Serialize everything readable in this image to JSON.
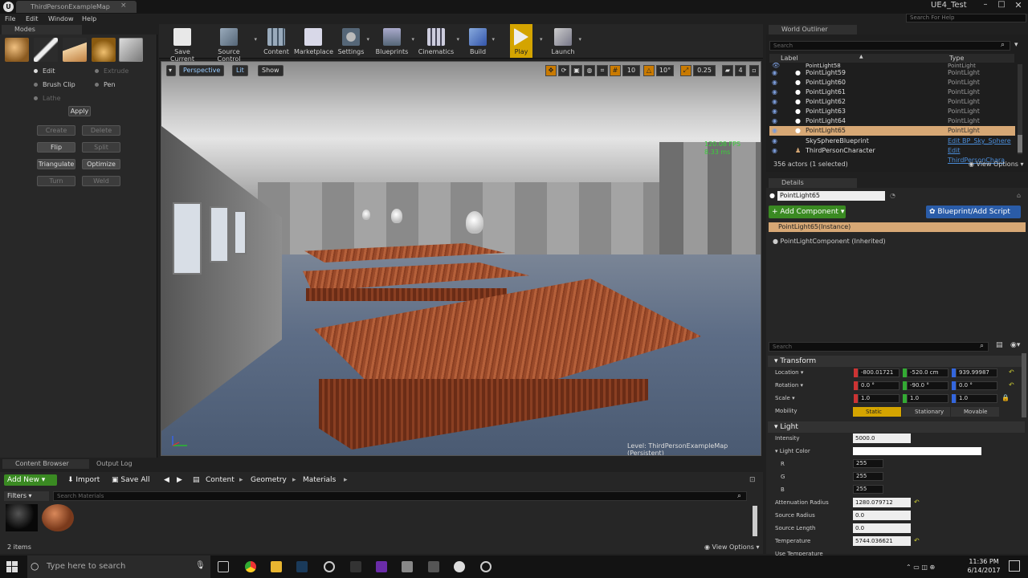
{
  "window": {
    "doc_tab": "ThirdPersonExampleMap",
    "project_name": "UE4_Test",
    "help_search_placeholder": "Search For Help"
  },
  "menu": [
    "File",
    "Edit",
    "Window",
    "Help"
  ],
  "modes": {
    "tab": "Modes",
    "radios": {
      "edit": "Edit",
      "extrude": "Extrude",
      "brush_clip": "Brush Clip",
      "pen": "Pen",
      "lathe": "Lathe"
    },
    "apply": "Apply",
    "buttons": {
      "create": "Create",
      "delete": "Delete",
      "flip": "Flip",
      "split": "Split",
      "triangulate": "Triangulate",
      "optimize": "Optimize",
      "turn": "Turn",
      "weld": "Weld"
    }
  },
  "toolbar": {
    "save_current": "Save Current",
    "source_control": "Source Control",
    "content": "Content",
    "marketplace": "Marketplace",
    "settings": "Settings",
    "blueprints": "Blueprints",
    "cinematics": "Cinematics",
    "build": "Build",
    "play": "Play",
    "launch": "Launch"
  },
  "viewport": {
    "perspective": "Perspective",
    "lit": "Lit",
    "show": "Show",
    "grid_snap": "10",
    "rot_snap": "10°",
    "scale_snap": "0.25",
    "cam_speed": "4",
    "fps": "120.08 FPS",
    "ms": "8.33 ms",
    "level": "Level:  ThirdPersonExampleMap (Persistent)"
  },
  "outliner": {
    "tab": "World Outliner",
    "search_placeholder": "Search",
    "col_label": "Label",
    "col_type": "Type",
    "rows": [
      {
        "label": "PointLight58",
        "type": "PointLight"
      },
      {
        "label": "PointLight59",
        "type": "PointLight"
      },
      {
        "label": "PointLight60",
        "type": "PointLight"
      },
      {
        "label": "PointLight61",
        "type": "PointLight"
      },
      {
        "label": "PointLight62",
        "type": "PointLight"
      },
      {
        "label": "PointLight63",
        "type": "PointLight"
      },
      {
        "label": "PointLight64",
        "type": "PointLight"
      },
      {
        "label": "PointLight65",
        "type": "PointLight"
      },
      {
        "label": "SkySphereBlueprint",
        "type": "Edit BP_Sky_Sphere"
      },
      {
        "label": "ThirdPersonCharacter",
        "type": "Edit ThirdPersonChara"
      }
    ],
    "count": "356 actors (1 selected)",
    "view_options": "View Options"
  },
  "details": {
    "tab": "Details",
    "actor_name": "PointLight65",
    "add_component": "+ Add Component",
    "blueprint_script": "Blueprint/Add Script",
    "instance": "PointLight65(Instance)",
    "component": "PointLightComponent (Inherited)",
    "search_placeholder": "Search",
    "transform": {
      "header": "Transform",
      "location_label": "Location",
      "location": [
        "-800.01721",
        "-520.0 cm",
        "939.99987"
      ],
      "rotation_label": "Rotation",
      "rotation": [
        "0.0 °",
        "-90.0 °",
        "0.0 °"
      ],
      "scale_label": "Scale",
      "scale": [
        "1.0",
        "1.0",
        "1.0"
      ],
      "mobility_label": "Mobility",
      "mobility": [
        "Static",
        "Stationary",
        "Movable"
      ]
    },
    "light": {
      "header": "Light",
      "intensity_label": "Intensity",
      "intensity": "5000.0",
      "light_color_label": "Light Color",
      "r_label": "R",
      "r": "255",
      "g_label": "G",
      "g": "255",
      "b_label": "B",
      "b": "255",
      "attenuation_label": "Attenuation Radius",
      "attenuation": "1280.079712",
      "source_radius_label": "Source Radius",
      "source_radius": "0.0",
      "source_length_label": "Source Length",
      "source_length": "0.0",
      "temperature_label": "Temperature",
      "temperature": "5744.036621",
      "use_temp_label": "Use Temperature"
    }
  },
  "content_browser": {
    "tab": "Content Browser",
    "output_tab": "Output Log",
    "add_new": "Add New",
    "import": "Import",
    "save_all": "Save All",
    "breadcrumbs": [
      "Content",
      "Geometry",
      "Materials"
    ],
    "filters": "Filters",
    "search_placeholder": "Search Materials",
    "count": "2 items",
    "view_options": "View Options"
  },
  "taskbar": {
    "search_placeholder": "Type here to search",
    "time": "11:36 PM",
    "date": "6/14/2017"
  }
}
